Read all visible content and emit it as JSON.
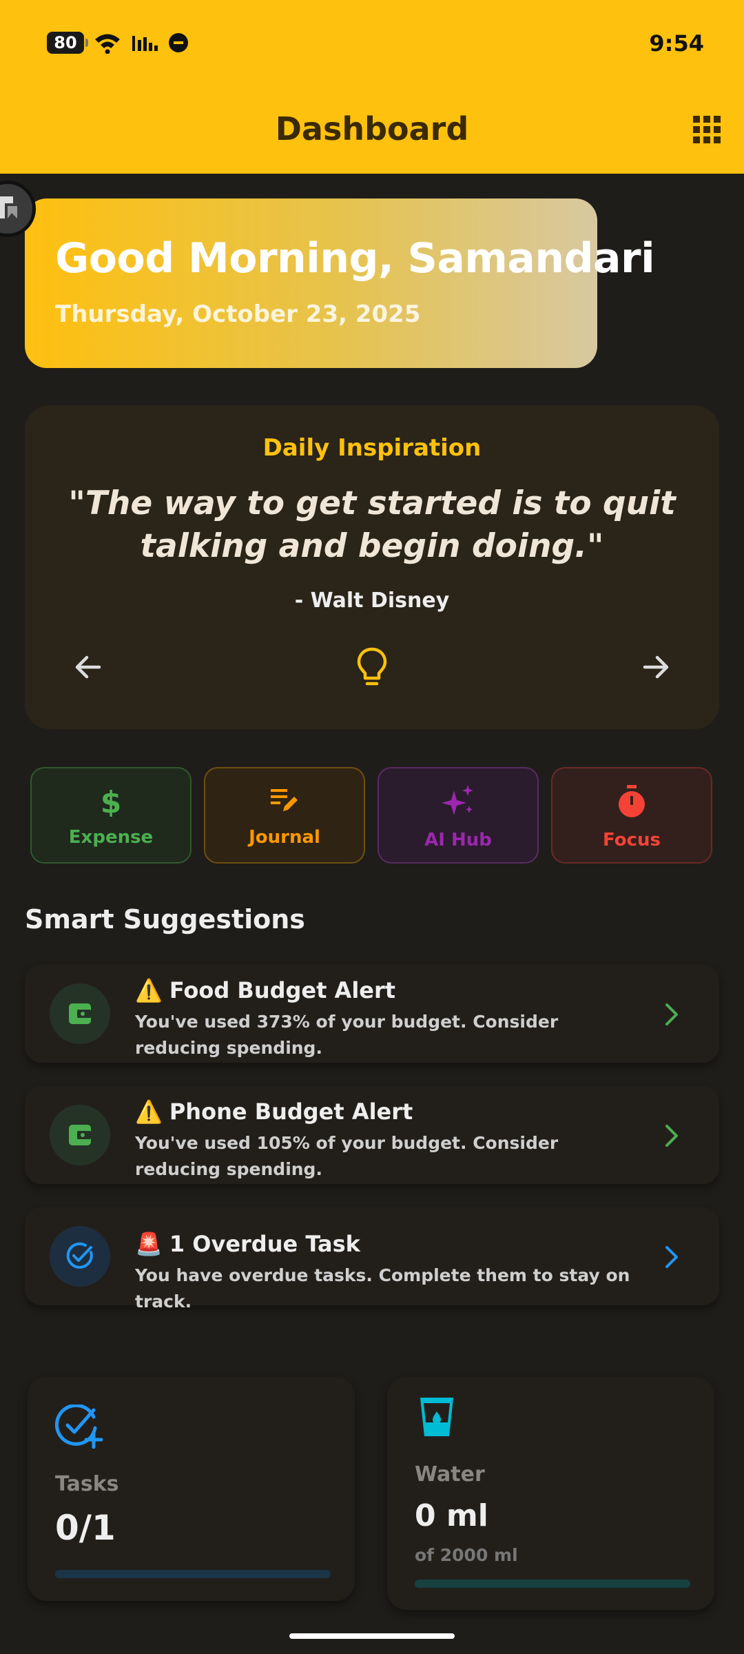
{
  "status_bar": {
    "battery": "80",
    "time": "9:54"
  },
  "app_bar": {
    "title": "Dashboard",
    "menu_icon": "grid-icon"
  },
  "greeting": {
    "title": "Good Morning, Samandari",
    "date": "Thursday, October 23, 2025"
  },
  "inspiration": {
    "heading": "Daily Inspiration",
    "quote": "\"The way to get started is to quit talking and begin doing.\"",
    "author": "- Walt Disney"
  },
  "quick_actions": [
    {
      "label": "Expense",
      "icon": "dollar-icon",
      "color": "#4caf50"
    },
    {
      "label": "Journal",
      "icon": "edit-note-icon",
      "color": "#ff9800"
    },
    {
      "label": "AI Hub",
      "icon": "sparkle-icon",
      "color": "#9c27b0"
    },
    {
      "label": "Focus",
      "icon": "timer-icon",
      "color": "#f44336"
    }
  ],
  "suggestions_title": "Smart Suggestions",
  "suggestions": [
    {
      "emoji": "⚠️",
      "title": "Food Budget Alert",
      "desc": "You've used 373% of your budget. Consider reducing spending.",
      "icon": "wallet-icon",
      "color": "#4caf50"
    },
    {
      "emoji": "⚠️",
      "title": "Phone Budget Alert",
      "desc": "You've used 105% of your budget. Consider reducing spending.",
      "icon": "wallet-icon",
      "color": "#4caf50"
    },
    {
      "emoji": "🚨",
      "title": "1 Overdue Task",
      "desc": "You have overdue tasks. Complete them to stay on track.",
      "icon": "check-circle-icon",
      "color": "#2196f3"
    }
  ],
  "stats": {
    "tasks": {
      "label": "Tasks",
      "value": "0/1",
      "progress": 0,
      "color": "#2196f3"
    },
    "water": {
      "label": "Water",
      "value": "0 ml",
      "sub": "of 2000 ml",
      "progress": 0,
      "color": "#00bcd4"
    }
  }
}
